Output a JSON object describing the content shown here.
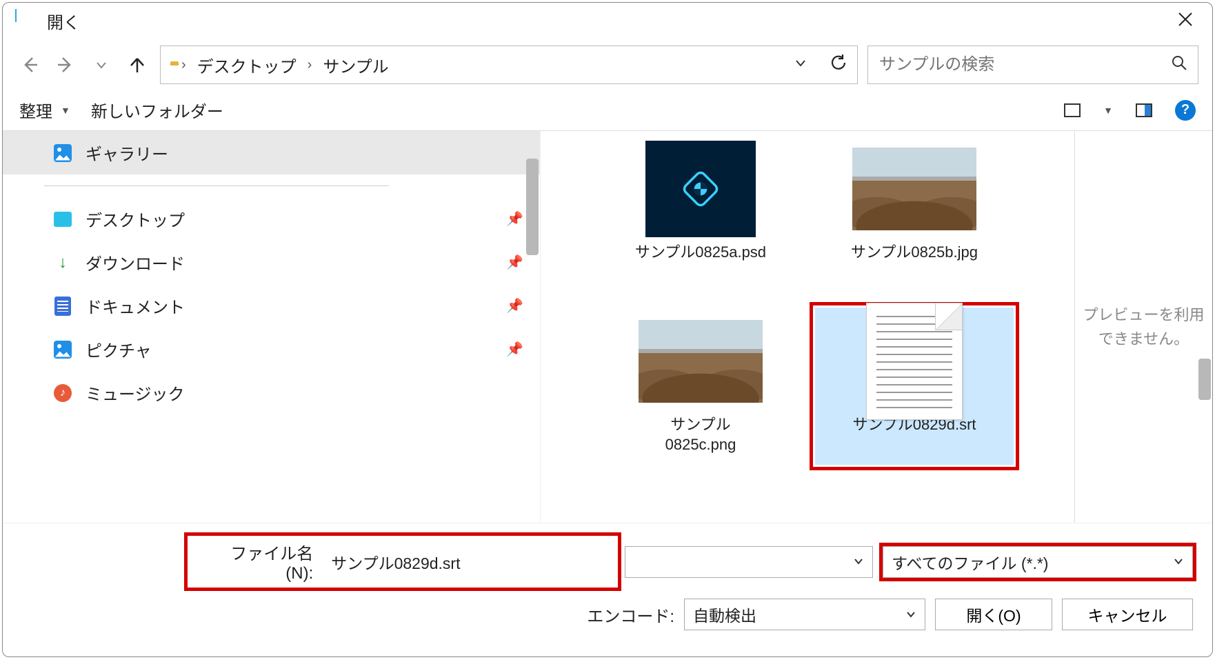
{
  "title": "開く",
  "breadcrumb": {
    "parts": [
      "デスクトップ",
      "サンプル"
    ]
  },
  "search": {
    "placeholder": "サンプルの検索"
  },
  "toolbar": {
    "organize": "整理",
    "newfolder": "新しいフォルダー"
  },
  "sidebar": {
    "gallery": "ギャラリー",
    "desktop": "デスクトップ",
    "downloads": "ダウンロード",
    "documents": "ドキュメント",
    "pictures": "ピクチャ",
    "music": "ミュージック"
  },
  "files": {
    "psd": "サンプル0825a.psd",
    "jpg": "サンプル0825b.jpg",
    "png_line1": "サンプル",
    "png_line2": "0825c.png",
    "srt": "サンプル0829d.srt"
  },
  "preview": {
    "unavailable": "プレビューを利用できません。"
  },
  "bottom": {
    "filename_label": "ファイル名(N):",
    "filename_value": "サンプル0829d.srt",
    "filter_value": "すべてのファイル  (*.*)",
    "encoding_label": "エンコード:",
    "encoding_value": "自動検出",
    "open": "開く(O)",
    "cancel": "キャンセル"
  },
  "icons": {
    "help": "?"
  }
}
